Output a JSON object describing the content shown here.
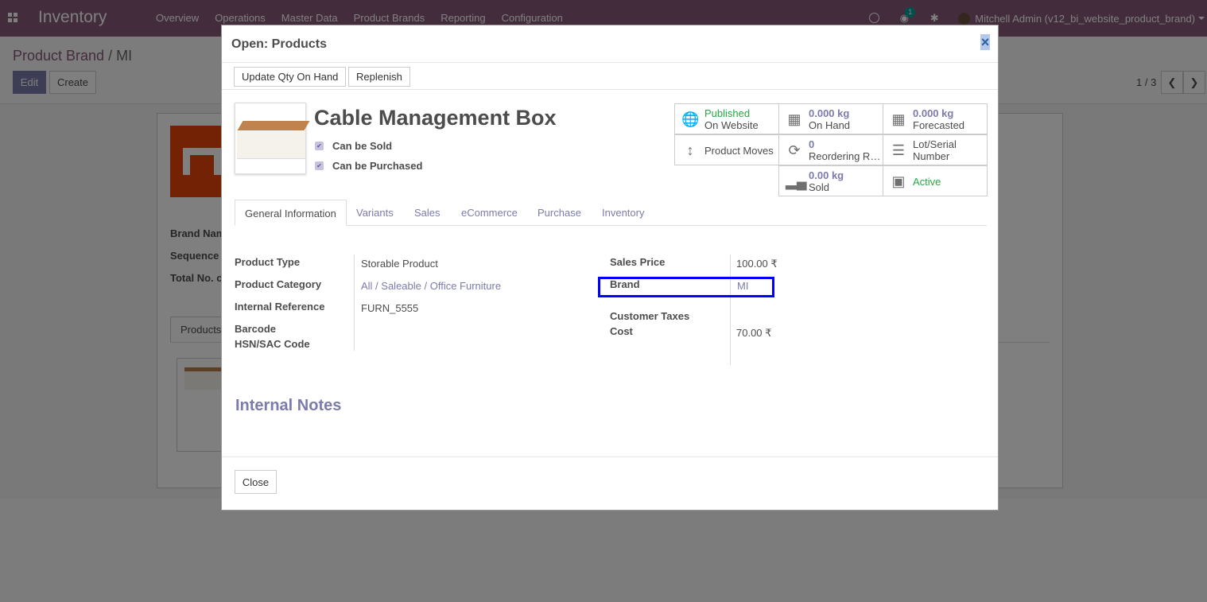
{
  "navbar": {
    "app_name": "Inventory",
    "menu": [
      "Overview",
      "Operations",
      "Master Data",
      "Product Brands",
      "Reporting",
      "Configuration"
    ],
    "message_count": "1",
    "user": "Mitchell Admin (v12_bi_website_product_brand)",
    "icons": [
      "apps-icon",
      "clock-icon",
      "chat-icon",
      "bug-icon",
      "avatar"
    ]
  },
  "control_panel": {
    "breadcrumb_parent": "Product Brand",
    "breadcrumb_sep": " / ",
    "breadcrumb_current": "MI",
    "edit_label": "Edit",
    "create_label": "Create",
    "pager": "1 / 3"
  },
  "background_form": {
    "labels": [
      "Brand Nam",
      "Sequence",
      "Total No. c"
    ],
    "tab": "Products"
  },
  "modal": {
    "title": "Open: Products",
    "close_x": "×",
    "buttons": {
      "update_qty": "Update Qty On Hand",
      "replenish": "Replenish"
    },
    "product_name": "Cable Management Box",
    "can_be_sold": "Can be Sold",
    "can_be_purchased": "Can be Purchased",
    "smart_buttons": {
      "published_line1": "Published",
      "published_line2": "On Website",
      "onhand_value": "0.000",
      "onhand_unit": "kg",
      "onhand_label": "On Hand",
      "forecast_value": "0.000",
      "forecast_unit": "kg",
      "forecast_label": "Forecasted",
      "moves_label": "Product Moves",
      "reorder_value": "0",
      "reorder_label": "Reordering Rules",
      "lot_line1": "Lot/Serial",
      "lot_line2": "Number",
      "sold_value": "0.00",
      "sold_unit": "kg",
      "sold_label": "Sold",
      "active_label": "Active"
    },
    "tabs": [
      "General Information",
      "Variants",
      "Sales",
      "eCommerce",
      "Purchase",
      "Inventory"
    ],
    "left_fields": {
      "product_type_label": "Product Type",
      "product_type": "Storable Product",
      "category_label": "Product Category",
      "category": "All / Saleable / Office Furniture",
      "ref_label": "Internal Reference",
      "ref": "FURN_5555",
      "barcode_label": "Barcode",
      "hsn_label": "HSN/SAC Code"
    },
    "right_fields": {
      "price_label": "Sales Price",
      "price": "100.00 ₹",
      "brand_label": "Brand",
      "brand": "MI",
      "taxes_label": "Customer Taxes",
      "cost_label": "Cost",
      "cost": "70.00 ₹"
    },
    "notes_title": "Internal Notes",
    "close_label": "Close"
  },
  "colors": {
    "navbar": "#875a7b",
    "primary": "#7c7bad",
    "highlight": "#0000ff",
    "success": "#28a745"
  }
}
